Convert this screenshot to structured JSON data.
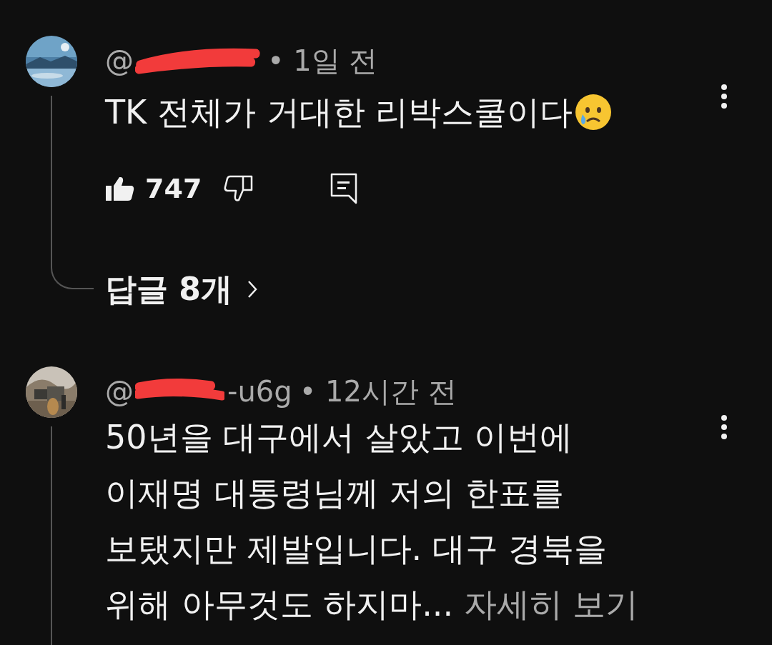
{
  "comments": [
    {
      "author": {
        "before": "@",
        "redacted": true
      },
      "time": "• 1일 전",
      "text": "TK 전체가 거대한 리박스쿨이다",
      "has_emoji": true,
      "likes": "747",
      "liked": true,
      "replies": "답글 8개"
    },
    {
      "author": {
        "before": "@",
        "redacted": true,
        "after": "-u6g"
      },
      "time": "• 12시간 전",
      "text": "50년을 대구에서 살았고 이번에\n이재명 대통령님께 저의 한표를\n보탰지만 제발입니다. 대구 경북을\n위해 아무것도 하지마...",
      "more": "자세히 보기",
      "has_emoji": false
    }
  ]
}
